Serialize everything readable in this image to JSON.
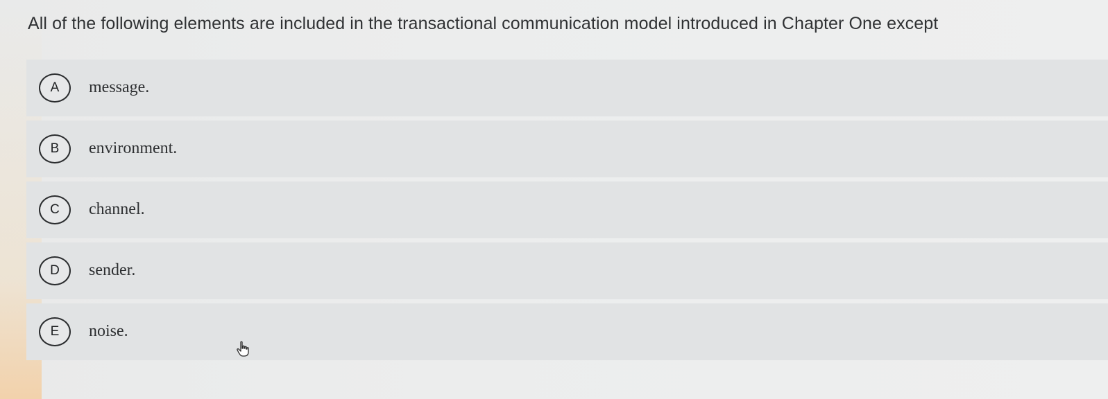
{
  "question": {
    "text": "All of the following elements are included in the transactional communication model introduced in Chapter One except"
  },
  "options": [
    {
      "letter": "A",
      "text": "message."
    },
    {
      "letter": "B",
      "text": "environment."
    },
    {
      "letter": "C",
      "text": "channel."
    },
    {
      "letter": "D",
      "text": "sender."
    },
    {
      "letter": "E",
      "text": "noise."
    }
  ],
  "cursor": {
    "icon": "hand-pointer-icon"
  }
}
